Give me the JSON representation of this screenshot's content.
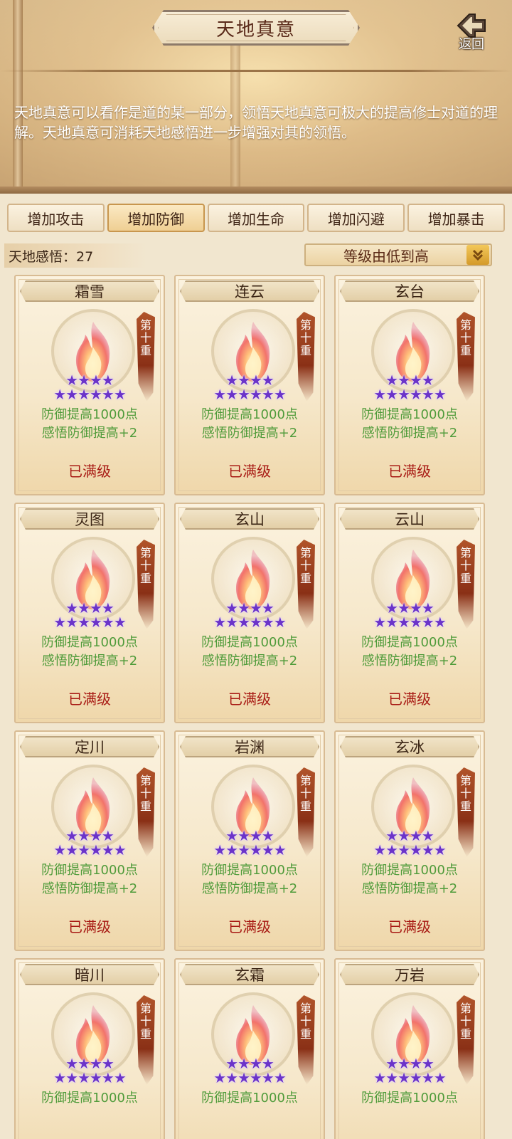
{
  "header": {
    "title": "天地真意",
    "back_label": "返回",
    "description": "天地真意可以看作是道的某一部分，领悟天地真意可极大的提高修士对道的理解。天地真意可消耗天地感悟进一步增强对其的领悟。"
  },
  "tabs": [
    {
      "label": "增加攻击",
      "active": false
    },
    {
      "label": "增加防御",
      "active": true
    },
    {
      "label": "增加生命",
      "active": false
    },
    {
      "label": "增加闪避",
      "active": false
    },
    {
      "label": "增加暴击",
      "active": false
    }
  ],
  "insight": {
    "label": "天地感悟：27"
  },
  "sort": {
    "label": "等级由低到高",
    "icon": "double-chevron-down-icon"
  },
  "colors": {
    "accent": "#d49a2a",
    "effect": "#4f9b3a",
    "status": "#a81a14",
    "stars": "#6b34c9"
  },
  "cards": [
    {
      "name": "霜雪",
      "rank": "第十重",
      "stars": 10,
      "effect1": "防御提高1000点",
      "effect2": "感悟防御提高+2",
      "status": "已满级"
    },
    {
      "name": "连云",
      "rank": "第十重",
      "stars": 10,
      "effect1": "防御提高1000点",
      "effect2": "感悟防御提高+2",
      "status": "已满级"
    },
    {
      "name": "玄台",
      "rank": "第十重",
      "stars": 10,
      "effect1": "防御提高1000点",
      "effect2": "感悟防御提高+2",
      "status": "已满级"
    },
    {
      "name": "灵图",
      "rank": "第十重",
      "stars": 10,
      "effect1": "防御提高1000点",
      "effect2": "感悟防御提高+2",
      "status": "已满级"
    },
    {
      "name": "玄山",
      "rank": "第十重",
      "stars": 10,
      "effect1": "防御提高1000点",
      "effect2": "感悟防御提高+2",
      "status": "已满级"
    },
    {
      "name": "云山",
      "rank": "第十重",
      "stars": 10,
      "effect1": "防御提高1000点",
      "effect2": "感悟防御提高+2",
      "status": "已满级"
    },
    {
      "name": "定川",
      "rank": "第十重",
      "stars": 10,
      "effect1": "防御提高1000点",
      "effect2": "感悟防御提高+2",
      "status": "已满级"
    },
    {
      "name": "岩渊",
      "rank": "第十重",
      "stars": 10,
      "effect1": "防御提高1000点",
      "effect2": "感悟防御提高+2",
      "status": "已满级"
    },
    {
      "name": "玄冰",
      "rank": "第十重",
      "stars": 10,
      "effect1": "防御提高1000点",
      "effect2": "感悟防御提高+2",
      "status": "已满级"
    },
    {
      "name": "暗川",
      "rank": "第十重",
      "stars": 10,
      "effect1": "防御提高1000点",
      "effect2": "",
      "status": ""
    },
    {
      "name": "玄霜",
      "rank": "第十重",
      "stars": 10,
      "effect1": "防御提高1000点",
      "effect2": "",
      "status": ""
    },
    {
      "name": "万岩",
      "rank": "第十重",
      "stars": 10,
      "effect1": "防御提高1000点",
      "effect2": "",
      "status": ""
    }
  ]
}
